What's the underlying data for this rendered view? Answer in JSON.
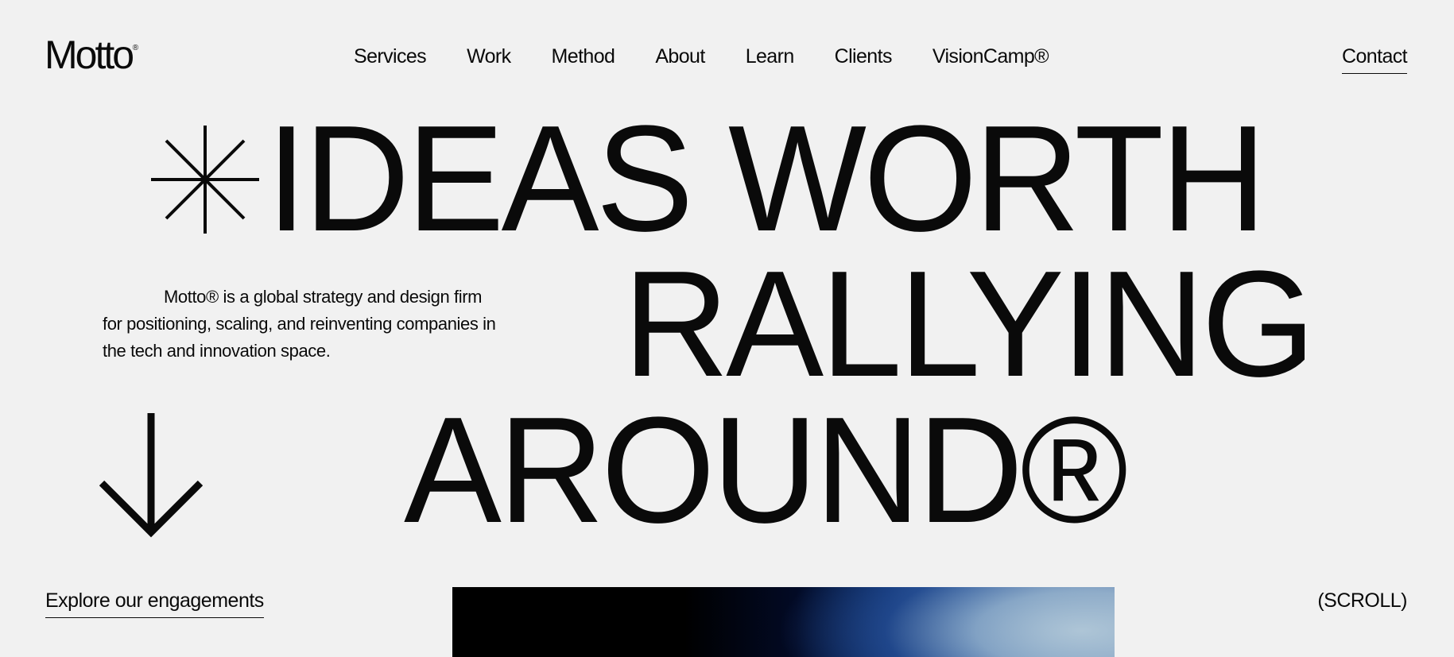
{
  "header": {
    "logo": "Motto",
    "logo_mark": "®",
    "nav": [
      {
        "label": "Services"
      },
      {
        "label": "Work"
      },
      {
        "label": "Method"
      },
      {
        "label": "About"
      },
      {
        "label": "Learn"
      },
      {
        "label": "Clients"
      },
      {
        "label": "VisionCamp®"
      }
    ],
    "contact": "Contact"
  },
  "hero": {
    "headline": [
      "IDEAS WORTH",
      "RALLYING",
      "AROUND®"
    ],
    "intro": "Motto® is a global strategy and design firm for positioning, scaling, and reinventing companies in the tech and innovation space.",
    "explore": "Explore our engagements",
    "scroll": "(SCROLL)"
  },
  "icons": {
    "asterisk": "asterisk-icon",
    "arrow": "arrow-down-icon"
  },
  "colors": {
    "background": "#f1f1f1",
    "text": "#0a0a0a"
  }
}
